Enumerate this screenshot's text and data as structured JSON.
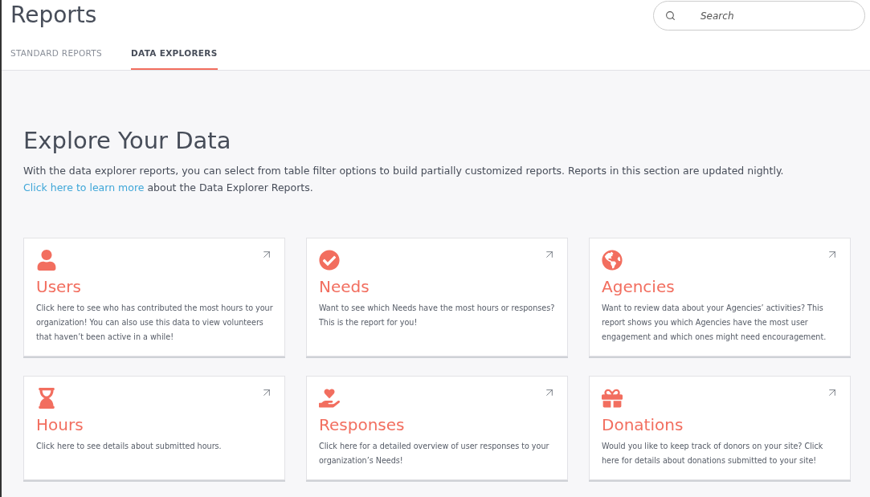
{
  "header": {
    "title": "Reports",
    "search": {
      "placeholder": "Search"
    }
  },
  "tabs": [
    {
      "label": "STANDARD REPORTS",
      "selected": false
    },
    {
      "label": "DATA EXPLORERS",
      "selected": true
    }
  ],
  "intro": {
    "heading": "Explore Your Data",
    "text_before": "With the data explorer reports, you can select from table filter options to build partially customized reports. Reports in this section are updated nightly.",
    "link": "Click here to learn more",
    "text_after": "about the Data Explorer Reports."
  },
  "cards": [
    {
      "kind": "user",
      "title": "Users",
      "description": "Click here to see who has contributed the most hours to your organization! You can also use this data to view volunteers that haven’t been active in a while!"
    },
    {
      "kind": "check",
      "title": "Needs",
      "description": "Want to see which Needs have the most hours or responses? This is the report for you!"
    },
    {
      "kind": "globe",
      "title": "Agencies",
      "description": "Want to review data about your Agencies’ activities? This report shows you which Agencies have the most user engagement and which ones might need encouragement."
    },
    {
      "kind": "hourglass",
      "title": "Hours",
      "description": "Click here to see details about submitted hours."
    },
    {
      "kind": "heart",
      "title": "Responses",
      "description": "Click here for a detailed overview of user responses to your organization’s Needs!"
    },
    {
      "kind": "gift",
      "title": "Donations",
      "description": "Would you like to keep track of donors on your site? Click here for details about donations submitted to your site!"
    }
  ]
}
